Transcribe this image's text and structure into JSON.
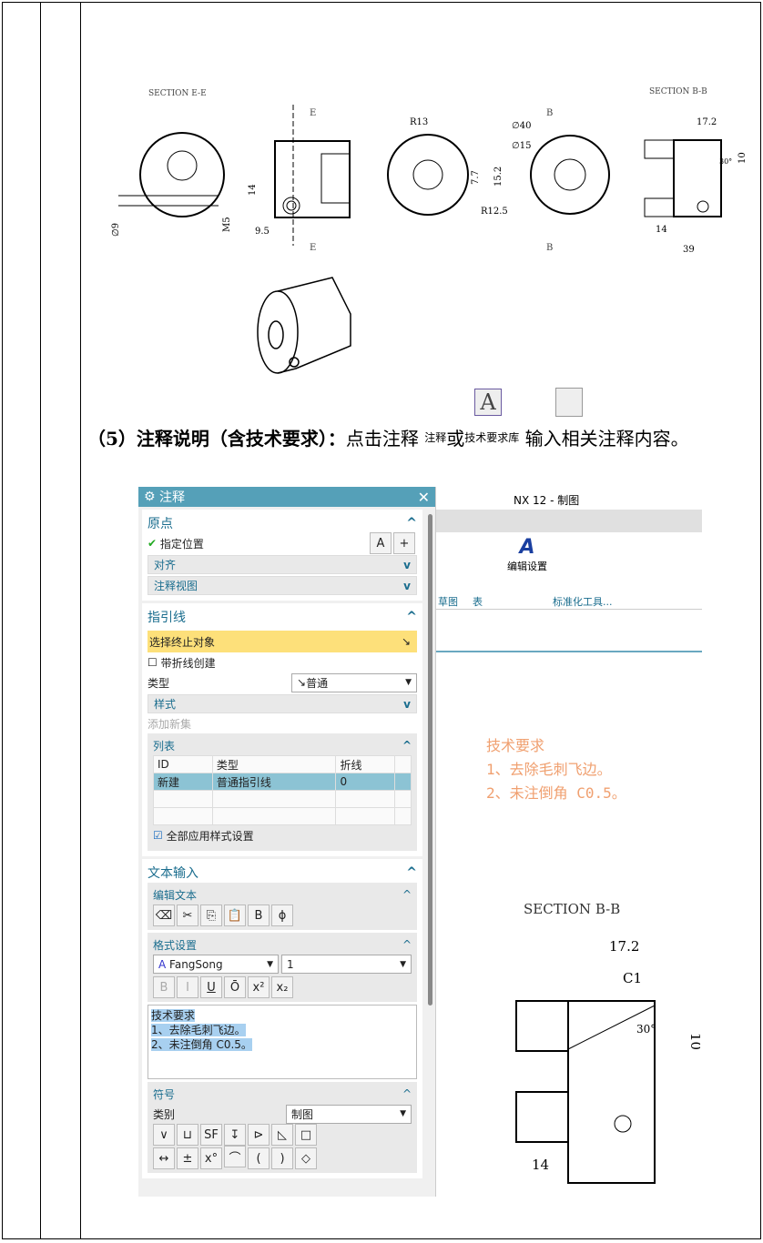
{
  "drawing": {
    "section_ee": "SECTION E-E",
    "section_bb": "SECTION B-B",
    "e": "E",
    "b": "B",
    "dims": {
      "d9": "∅9",
      "m5": "M5",
      "d14": "14",
      "d95": "9.5",
      "r13": "R13",
      "r125": "R12.5",
      "d77": "7.7",
      "d152": "15.2",
      "d40": "∅40",
      "d15": "∅15",
      "d172": "17.2",
      "d10": "10",
      "a30": "30°",
      "d14b": "14",
      "d39": "39"
    }
  },
  "icons": {
    "note_label": "注释",
    "techreq_label": "技术要求库"
  },
  "paragraph": {
    "bold": "（5）注释说明（含技术要求）：",
    "text1": "点击注释",
    "or": "或",
    "text2": "输入相关注释内容。"
  },
  "dialog": {
    "title": "注释",
    "origin": {
      "header": "原点",
      "specify": "指定位置",
      "align": "对齐",
      "view": "注释视图"
    },
    "leader": {
      "header": "指引线",
      "select": "选择终止对象",
      "jog": "带折线创建",
      "type_label": "类型",
      "type_value": "普通",
      "style": "样式",
      "add_set": "添加新集",
      "list": "列表",
      "columns": [
        "ID",
        "类型",
        "折线"
      ],
      "rows": [
        [
          "新建",
          "普通指引线",
          "0"
        ]
      ],
      "apply_all": "全部应用样式设置"
    },
    "text_input": {
      "header": "文本输入",
      "edit": "编辑文本",
      "format": "格式设置",
      "font": "FangSong",
      "size": "1",
      "lines": [
        "技术要求",
        "1、去除毛刺飞边。",
        "2、未注倒角 C0.5。"
      ]
    },
    "symbols": {
      "header": "符号",
      "category_label": "类别",
      "category_value": "制图"
    }
  },
  "app": {
    "title": "NX 12 - 制图",
    "edit_settings": "编辑设置",
    "group1": "草图",
    "group2": "表",
    "group3": "标准化工具...",
    "notes": [
      "技术要求",
      "1、去除毛刺飞边。",
      "2、未注倒角 C0.5。"
    ],
    "section": "SECTION B-B",
    "d172": "17.2",
    "c1": "C1",
    "d10": "10",
    "a30": "30°",
    "d14": "14"
  }
}
